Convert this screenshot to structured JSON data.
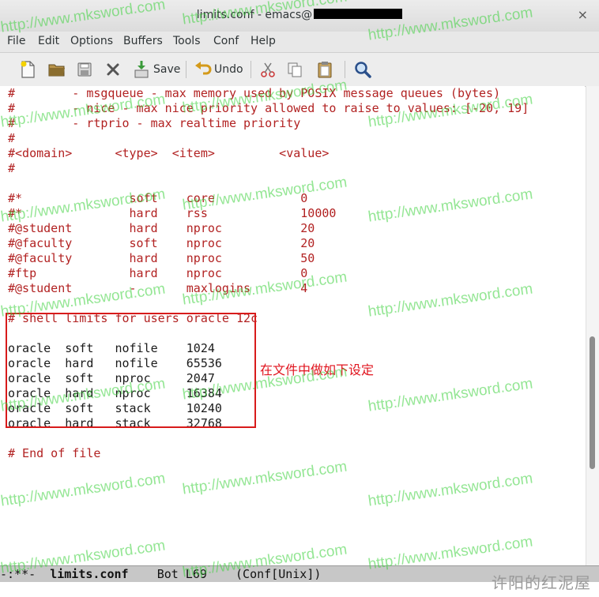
{
  "window": {
    "title": "limits.conf - emacs@",
    "close_glyph": "×"
  },
  "menubar": [
    "File",
    "Edit",
    "Options",
    "Buffers",
    "Tools",
    "Conf",
    "Help"
  ],
  "toolbar": {
    "save_label": "Save",
    "undo_label": "Undo",
    "icons": [
      "new-file-icon",
      "open-folder-icon",
      "save-disk-icon",
      "close-x-icon",
      "save-icon",
      "undo-icon",
      "cut-icon",
      "copy-icon",
      "paste-icon",
      "search-icon"
    ]
  },
  "editor": {
    "lines": [
      "#        - msgqueue - max memory used by POSIX message queues (bytes)",
      "#        - nice - max nice priority allowed to raise to values: [-20, 19]",
      "#        - rtprio - max realtime priority",
      "#",
      "#<domain>      <type>  <item>         <value>",
      "#",
      "",
      "#*               soft    core            0",
      "#*               hard    rss             10000",
      "#@student        hard    nproc           20",
      "#@faculty        soft    nproc           20",
      "#@faculty        hard    nproc           50",
      "#ftp             hard    nproc           0",
      "#@student        -       maxlogins       4",
      "",
      "# shell limits for users oracle 12c",
      "",
      "oracle  soft   nofile    1024",
      "oracle  hard   nofile    65536",
      "oracle  soft   nproc     2047",
      "oracle  hard   nproc     16384",
      "oracle  soft   stack     10240",
      "oracle  hard   stack     32768",
      "",
      "# End of file"
    ],
    "annotation": "在文件中做如下设定"
  },
  "modeline": {
    "status": "-:**-",
    "buffer": "limits.conf",
    "position": "Bot L69",
    "mode": "(Conf[Unix])"
  },
  "watermark": "http://www.mksword.com",
  "signature": "许阳的红泥屋",
  "colors": {
    "comment": "#b22222",
    "annotation_red": "#e0141e",
    "watermark_green": "#3cd23c",
    "modeline_bg": "#c7c7c7"
  }
}
